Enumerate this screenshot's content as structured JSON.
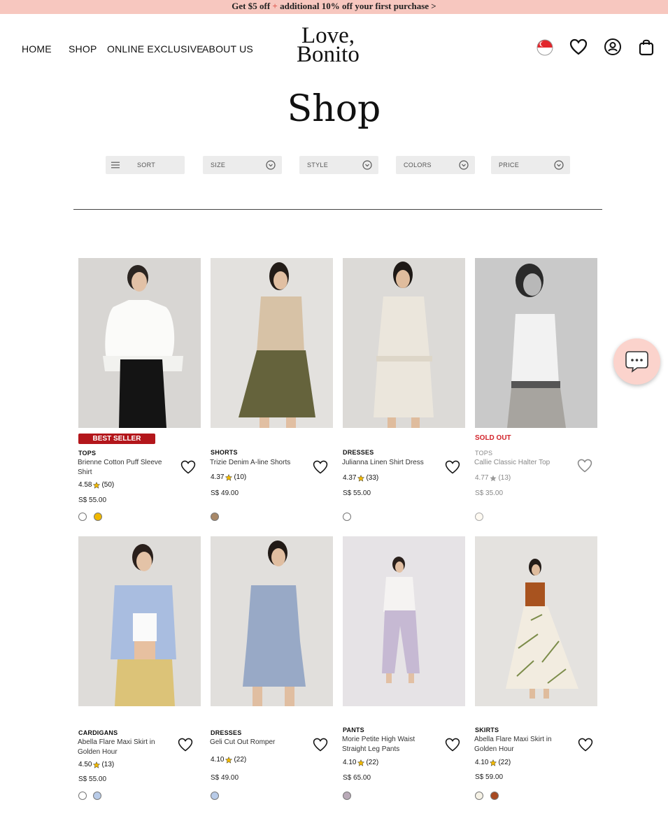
{
  "promo": {
    "part1": "Get $5 off",
    "plus": "+",
    "part2": "additional 10% off your first purchase >"
  },
  "nav": {
    "home": "HOME",
    "shop": "SHOP",
    "online_exclusive": "ONLINE EXCLUSIVE",
    "about": "ABOUT US"
  },
  "logo": {
    "line1": "Love,",
    "line2": "Bonito"
  },
  "header_icons": [
    "singapore-flag-icon",
    "heart-icon",
    "account-icon",
    "shopping-bag-icon"
  ],
  "page_title": "Shop",
  "filters": {
    "sort": "SORT",
    "size": "SIZE",
    "style": "STYLE",
    "colors": "COLORS",
    "price": "PRICE"
  },
  "products": [
    {
      "badge": "BEST SELLER",
      "category": "TOPS",
      "name": "Brienne Cotton Puff Sleeve Shirt",
      "rating": "4.58",
      "reviews": "(50)",
      "price": "S$ 55.00",
      "swatches": [
        "#ffffff",
        "#f0b800"
      ]
    },
    {
      "category": "SHORTS",
      "name": "Trizie Denim A-line Shorts",
      "rating": "4.37",
      "reviews": "(10)",
      "price": "S$ 49.00",
      "swatches": [
        "#a88868"
      ]
    },
    {
      "category": "DRESSES",
      "name": "Julianna Linen Shirt Dress",
      "rating": "4.37",
      "reviews": "(33)",
      "price": "S$ 55.00",
      "swatches": [
        "#ffffff"
      ]
    },
    {
      "badge": "SOLD OUT",
      "category": "TOPS",
      "name": "Callie Classic Halter Top",
      "rating": "4.77",
      "reviews": "(13)",
      "price": "S$ 35.00",
      "swatches": [
        "#fffaf2"
      ]
    },
    {
      "category": "CARDIGANS",
      "name": "Abella Flare Maxi Skirt in Golden Hour",
      "rating": "4.50",
      "reviews": "(13)",
      "price": "S$ 55.00",
      "swatches": [
        "#ffffff",
        "#b8cbe8"
      ]
    },
    {
      "category": "DRESSES",
      "name": "Geli Cut Out Romper",
      "rating": "4.10",
      "reviews": "(22)",
      "price": "S$ 49.00",
      "swatches": [
        "#b8cbe8"
      ]
    },
    {
      "category": "PANTS",
      "name": "Morie Petite High Waist Straight Leg Pants",
      "rating": "4.10",
      "reviews": "(22)",
      "price": "S$ 65.00",
      "swatches": [
        "#b9aab8"
      ]
    },
    {
      "category": "SKIRTS",
      "name": "Abella Flare Maxi Skirt in Golden Hour",
      "rating": "4.10",
      "reviews": "(22)",
      "price": "S$ 59.00",
      "swatches": [
        "#f6f2e6",
        "#a84a22"
      ]
    }
  ],
  "colors": {
    "promo_bg": "#f7c7bf",
    "badge_red": "#b3161b",
    "sold_out": "#d2232a",
    "star": "#f0b800",
    "chat_bg": "#fbd3cc"
  }
}
